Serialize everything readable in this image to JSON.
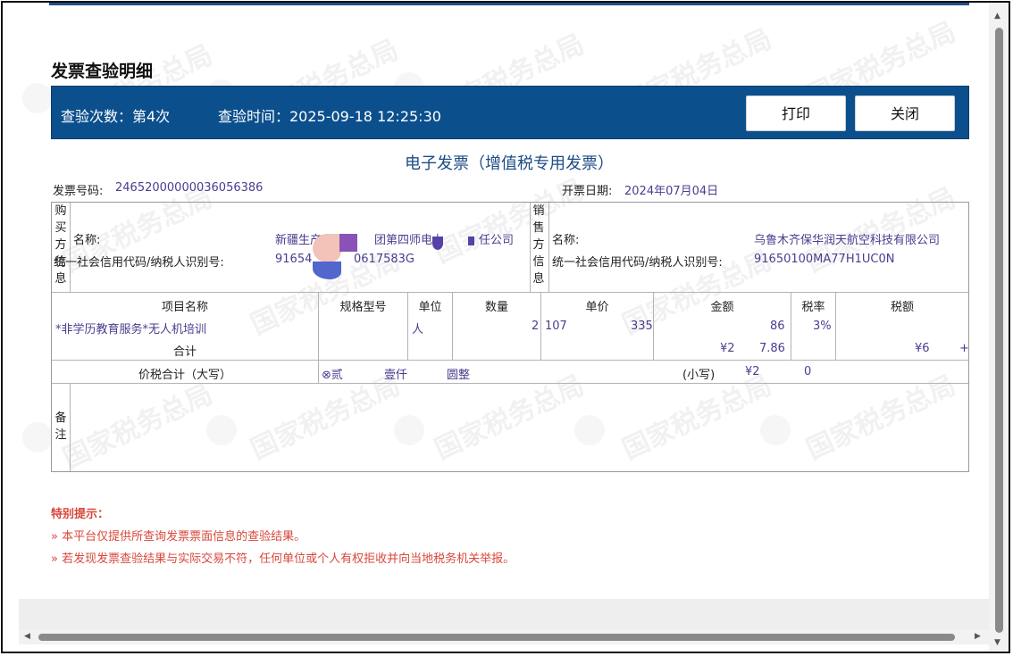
{
  "dialog": {
    "title": "发票查验明细",
    "check_count": "查验次数：第4次",
    "check_time": "查验时间：2025-09-18 12:25:30",
    "print_label": "打印",
    "close_label": "关闭"
  },
  "watermark_text": "国家税务总局",
  "invoice": {
    "type_title": "电子发票（增值税专用发票）",
    "number_label": "发票号码:",
    "number": "24652000000036056386",
    "date_label": "开票日期:",
    "date": "2024年07月04日",
    "buyer": {
      "side_label": [
        "购",
        "买",
        "方",
        "信",
        "息"
      ],
      "name_label": "名称:",
      "name_part1": "新疆生产",
      "name_part2": "团第四师电力",
      "name_part3": "任公司",
      "tax_label": "统一社会信用代码/纳税人识别号:",
      "tax_part1": "91654",
      "tax_part2": "0617583G"
    },
    "seller": {
      "side_label": [
        "销",
        "售",
        "方",
        "信",
        "息"
      ],
      "name_label": "名称:",
      "name": "乌鲁木齐保华润天航空科技有限公司",
      "tax_label": "统一社会信用代码/纳税人识别号:",
      "tax_id": "91650100MA77H1UC0N"
    },
    "columns": {
      "item": "项目名称",
      "spec": "规格型号",
      "unit": "单位",
      "qty": "数量",
      "price": "单价",
      "amount": "金额",
      "rate": "税率",
      "tax": "税额"
    },
    "row": {
      "item": "*非学历教育服务*无人机培训",
      "unit": "人",
      "qty": "2",
      "price_a": "107",
      "price_b": "335",
      "amount": "86",
      "rate": "3%",
      "tax": ""
    },
    "subtotal_label": "合计",
    "subtotal_amount_a": "¥2",
    "subtotal_amount_b": "7.86",
    "subtotal_tax_a": "¥6",
    "subtotal_tax_b": "+",
    "total_label": "价税合计（大写）",
    "total_upper_a": "⊗贰",
    "total_upper_b": "壹仟",
    "total_upper_c": "圆整",
    "total_lower_label": "(小写)",
    "total_lower_a": "¥2",
    "total_lower_b": "0",
    "remark_label": [
      "备",
      "注"
    ]
  },
  "notice": {
    "title": "特别提示：",
    "items": [
      "»  本平台仅提供所查询发票票面信息的查验结果。",
      "»  若发现发票查验结果与实际交易不符，任何单位或个人有权拒收并向当地税务机关举报。"
    ]
  },
  "colors": {
    "header_blue": "#0b4f8d",
    "title_blue": "#1d4c86",
    "value_purple": "#4a3d8f",
    "notice_red": "#d8473a"
  }
}
